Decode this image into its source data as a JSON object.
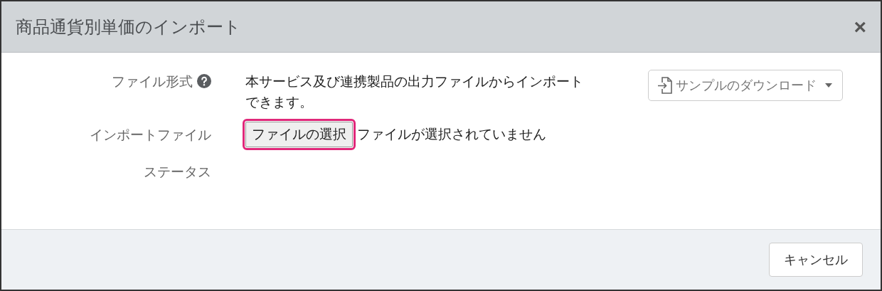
{
  "dialog": {
    "title": "商品通貨別単価のインポート",
    "close": "×"
  },
  "fields": [
    {
      "kind": "info",
      "label": "ファイル形式",
      "help": true,
      "text": "本サービス及び連携製品の出力ファイルからインポートできます。",
      "menu_button": "サンプルのダウンロード"
    },
    {
      "kind": "file",
      "label": "インポートファイル",
      "button": "ファイルの選択",
      "highlighted": true,
      "value": "ファイルが選択されていません"
    },
    {
      "kind": "empty",
      "label": "ステータス"
    }
  ],
  "footer": {
    "buttons": [
      "キャンセル"
    ]
  }
}
